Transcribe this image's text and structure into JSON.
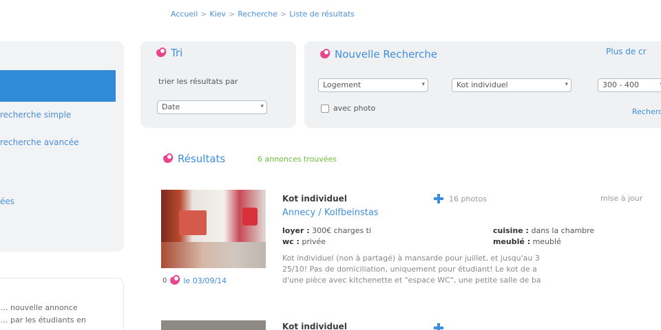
{
  "breadcrumb": {
    "items": [
      "Accueil",
      "Kiev",
      "Recherche",
      "Liste de résultats"
    ],
    "separator": ">"
  },
  "sidebar": {
    "links": [
      "recherche simple",
      "recherche avancée",
      "",
      "ées"
    ],
    "box_text": [
      "... nouvelle annonce",
      "... par les étudiants en"
    ]
  },
  "tri": {
    "title": "Tri",
    "label": "trier les résultats par",
    "select_value": "Date"
  },
  "recherche": {
    "title": "Nouvelle Recherche",
    "more_link": "Plus de cr",
    "type_select": "Logement",
    "kind_select": "Kot individuel",
    "price_select": "300 - 400",
    "photo_label": "avec photo",
    "search_link": "Rechercher"
  },
  "results": {
    "title": "Résultats",
    "count": "6 annonces trouvées"
  },
  "listing1": {
    "title": "Kot individuel",
    "location": "Annecy / Kolfbeinstas",
    "photos": "16 photos",
    "mise_text": "mise à jour",
    "loyer_label": "loyer :",
    "loyer_value": "300€ charges ti",
    "wc_label": "wc :",
    "wc_value": "privée",
    "cuisine_label": "cuisine :",
    "cuisine_value": "dans la chambre",
    "meuble_label": "meublé :",
    "meuble_value": "meublé",
    "desc_line1": "Kot individuel (non à partagé) à mansarde pour juillet, et jusqu'au 3",
    "desc_line2": "25/10! Pas de domiciliation, uniquement pour étudiant! Le kot de a",
    "desc_line3": "d'une pièce avec kitchenette et \"espace WC\", une petite salle de ba",
    "date": "le 03/09/14"
  },
  "listing2": {
    "title": "Kot individuel"
  },
  "colors": {
    "accent": "#3d8ede",
    "active_nav": "#2f8ad8",
    "pink_icon": "#e8458b",
    "count_green": "#6bbf3a"
  },
  "icons": {
    "tri": "pink-bag-icon",
    "recherche": "pink-bag-icon",
    "results": "pink-bag-icon",
    "photos": "plus-icon",
    "date": "pink-bag-icon"
  }
}
